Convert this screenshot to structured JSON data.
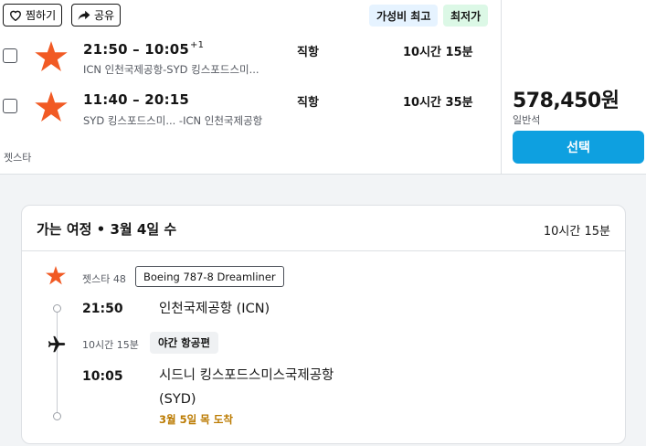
{
  "toolbar": {
    "save_label": "찜하기",
    "share_label": "공유"
  },
  "badges": {
    "best_value": "가성비 최고",
    "cheapest": "최저가"
  },
  "result": {
    "outbound": {
      "time": "21:50 – 10:05",
      "day_offset": "+1",
      "route": "ICN 인천국제공항-SYD 킹스포드스미...",
      "stops": "직항",
      "duration": "10시간 15분"
    },
    "inbound": {
      "time": "11:40 – 20:15",
      "route": "SYD 킹스포드스미... -ICN 인천국제공항",
      "stops": "직항",
      "duration": "10시간 35분"
    },
    "airline": "젯스타",
    "price": "578,450원",
    "cabin": "일반석",
    "select_label": "선택"
  },
  "detail": {
    "title": "가는 여정 • 3월 4일 수",
    "total_duration": "10시간 15분",
    "flight": "젯스타 48",
    "aircraft": "Boeing 787-8 Dreamliner",
    "departure": {
      "time": "21:50",
      "airport": "인천국제공항 (ICN)"
    },
    "segment_duration": "10시간 15분",
    "night_flight": "야간 항공편",
    "arrival": {
      "time": "10:05",
      "airport_line1": "시드니 킹스포드스미스국제공항",
      "airport_line2": "(SYD)",
      "arrival_note": "3월 5일 목 도착"
    }
  },
  "colors": {
    "accent": "#0ea0e0",
    "brand": "#f15a24",
    "arrival_note": "#bb7a00"
  },
  "icons": {
    "save": "heart-icon",
    "share": "share-arrow-icon",
    "airline": "jetstar-star-icon",
    "flight": "airplane-icon"
  }
}
